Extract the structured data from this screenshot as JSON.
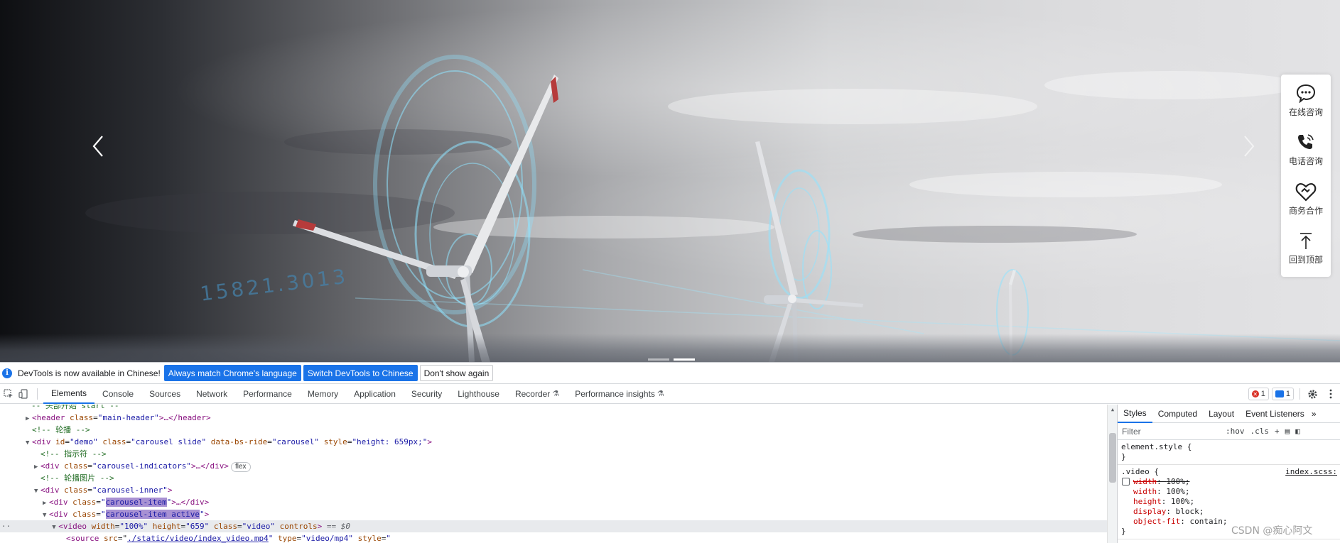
{
  "carousel": {
    "watermark_number": "15821.3013",
    "prev_label": "‹",
    "next_label": "›",
    "indicator_count": 2
  },
  "side_tools": [
    {
      "label": "在线咨询",
      "icon": "chat-bubble-icon"
    },
    {
      "label": "电话咨询",
      "icon": "phone-icon"
    },
    {
      "label": "商务合作",
      "icon": "handshake-heart-icon"
    },
    {
      "label": "回到顶部",
      "icon": "arrow-up-icon"
    }
  ],
  "devtools": {
    "infobar": {
      "message": "DevTools is now available in Chinese!",
      "btn_match": "Always match Chrome's language",
      "btn_switch": "Switch DevTools to Chinese",
      "btn_dont_show": "Don't show again"
    },
    "tabs": [
      "Elements",
      "Console",
      "Sources",
      "Network",
      "Performance",
      "Memory",
      "Application",
      "Security",
      "Lighthouse",
      "Recorder",
      "Performance insights"
    ],
    "active_tab": "Elements",
    "error_count": "1",
    "message_count": "1",
    "dom": {
      "l0": "-- 头部开始 start --",
      "l1_tag_open": "<header",
      "l1_attr": "class",
      "l1_val": "\"main-header\"",
      "l1_rest": ">…</header>",
      "l2": "<!-- 轮播 -->",
      "l3_tag": "<div",
      "l3_a1": "id",
      "l3_v1": "\"demo\"",
      "l3_a2": "class",
      "l3_v2": "\"carousel slide\"",
      "l3_a3": "data-bs-ride",
      "l3_v3": "\"carousel\"",
      "l3_a4": "style",
      "l3_v4": "\"height: 659px;\"",
      "l3_end": ">",
      "l4": "<!-- 指示符 -->",
      "l5_tag": "<div",
      "l5_a": "class",
      "l5_v": "\"carousel-indicators\"",
      "l5_rest": ">…</div>",
      "l5_badge": "flex",
      "l6": "<!-- 轮播图片 -->",
      "l7_tag": "<div",
      "l7_a": "class",
      "l7_v": "\"carousel-inner\"",
      "l7_end": ">",
      "l8_tag": "<div",
      "l8_a": "class",
      "l8_q1": "\"",
      "l8_hl": "carousel-item",
      "l8_q2": "\"",
      "l8_rest": ">…</div>",
      "l9_tag": "<div",
      "l9_a": "class",
      "l9_q1": "\"",
      "l9_hl": "carousel-item active",
      "l9_q2": "\"",
      "l9_end": ">",
      "l10_tag": "<video",
      "l10_a1": "width",
      "l10_v1": "\"100%\"",
      "l10_a2": "height",
      "l10_v2": "\"659\"",
      "l10_a3": "class",
      "l10_v3": "\"video\"",
      "l10_a4": "controls",
      "l10_end": ">",
      "l10_dollar": "== $0",
      "l11_tag": "<source",
      "l11_a1": "src",
      "l11_v1": "./static/video/index_video.mp4",
      "l11_a2": "type",
      "l11_v2": "\"video/mp4\"",
      "l11_a3": "style",
      "l11_v3": "\""
    },
    "styles": {
      "tabs": [
        "Styles",
        "Computed",
        "Layout",
        "Event Listeners"
      ],
      "more": "»",
      "filter_placeholder": "Filter",
      "hov": ":hov",
      "cls": ".cls",
      "plus": "+",
      "element_style_selector": "element.style {",
      "close_brace": "}",
      "rule_selector": ".video {",
      "rule_source": "index.scss:",
      "props": [
        {
          "name": "width",
          "value": "100%;",
          "struck": true
        },
        {
          "name": "width",
          "value": "100%;",
          "struck": false
        },
        {
          "name": "height",
          "value": "100%;",
          "struck": false
        },
        {
          "name": "display",
          "value": "block;",
          "struck": false
        },
        {
          "name": "object-fit",
          "value": "contain;",
          "struck": false
        }
      ]
    }
  },
  "watermark": "CSDN @痴心阿文"
}
